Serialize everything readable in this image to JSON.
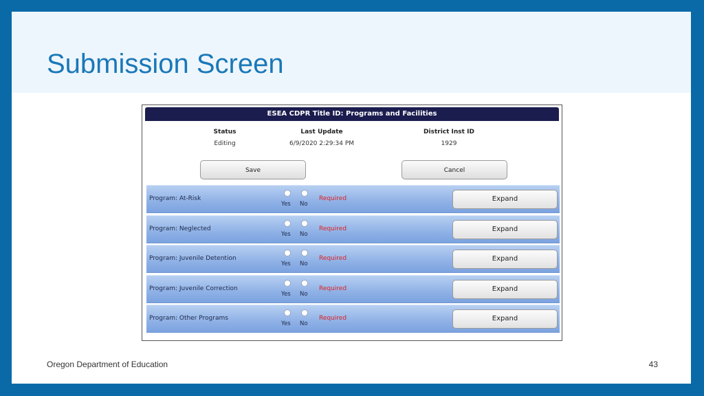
{
  "slide": {
    "title": "Submission Screen",
    "footer": "Oregon Department of Education",
    "page_number": "43"
  },
  "app": {
    "title": "ESEA CDPR Title ID: Programs and Facilities",
    "info": {
      "status_label": "Status",
      "status_value": "Editing",
      "last_update_label": "Last Update",
      "last_update_value": "6/9/2020 2:29:34 PM",
      "district_label": "District Inst ID",
      "district_value": "1929"
    },
    "buttons": {
      "save": "Save",
      "cancel": "Cancel"
    },
    "programs": [
      {
        "label": "Program: At-Risk",
        "yes": "Yes",
        "no": "No",
        "required": "Required",
        "expand": "Expand"
      },
      {
        "label": "Program: Neglected",
        "yes": "Yes",
        "no": "No",
        "required": "Required",
        "expand": "Expand"
      },
      {
        "label": "Program: Juvenile Detention",
        "yes": "Yes",
        "no": "No",
        "required": "Required",
        "expand": "Expand"
      },
      {
        "label": "Program: Juvenile Correction",
        "yes": "Yes",
        "no": "No",
        "required": "Required",
        "expand": "Expand"
      },
      {
        "label": "Program: Other Programs",
        "yes": "Yes",
        "no": "No",
        "required": "Required",
        "expand": "Expand"
      }
    ]
  },
  "colors": {
    "frame": "#0a6aa8",
    "title": "#1a78b8",
    "app_titlebar": "#1b1d4f",
    "required": "#e02020"
  }
}
